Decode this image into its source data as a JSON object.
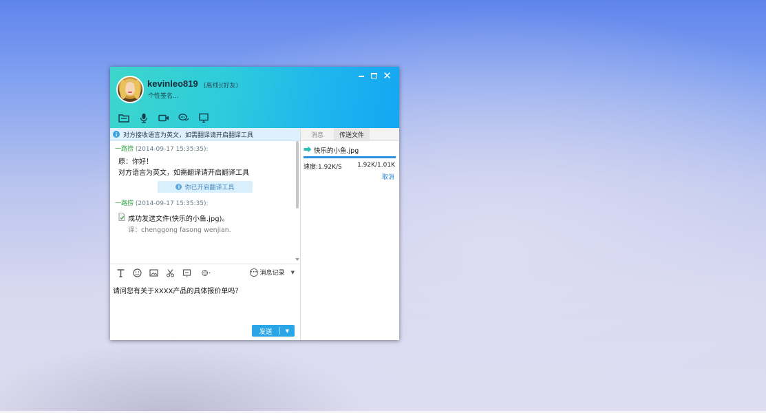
{
  "window": {
    "contact": {
      "nickname": "kevinleo819",
      "status": "[离线](好友)",
      "signature": "个性签名..."
    },
    "controls": {
      "minimize": "—",
      "maximize": "□",
      "close": "✕"
    },
    "top_toolbar": [
      "folder-icon",
      "microphone-icon",
      "video-camera-icon",
      "chat-bubbles-icon",
      "screen-share-icon"
    ],
    "notice": {
      "icon": "i",
      "text": "对方接收语言为英文，如需翻译请开启翻译工具"
    },
    "messages": [
      {
        "sender": "一路捞",
        "time": "(2014-09-17 15:35:35):",
        "lines": [
          "原：你好！",
          "对方语言为英文，如需翻译请开启翻译工具"
        ],
        "pill": "你已开启翻译工具"
      },
      {
        "sender": "一路捞",
        "time": "(2014-09-17 15:35:35):",
        "file_text": "成功发送文件(快乐的小鱼.jpg)。",
        "translit": "译：chenggong fasong wenjian."
      }
    ],
    "input_toolbar": {
      "tools": [
        "font-icon",
        "emoji-icon",
        "image-icon",
        "scissors-icon",
        "shake-icon",
        "globe-icon"
      ],
      "history_label": "消息记录",
      "history_caret": "▼"
    },
    "input": {
      "text": "请问您有关于XXXX产品的具体报价单吗？"
    },
    "send": {
      "label": "发送",
      "dropdown": "▼"
    },
    "right_panel": {
      "tabs": [
        "消息",
        "传送文件"
      ],
      "active_tab": 1,
      "transfer": {
        "file_name": "快乐的小鱼.jpg",
        "progress": 1.0,
        "speed": "速度:1.92K/S",
        "size": "1.92K/1.01K",
        "cancel": "取消"
      }
    },
    "colors": {
      "title_gradient_start": "#3dd6cc",
      "title_gradient_end": "#15a6f2",
      "sender_name": "#3aa84c",
      "send_button": "#2aa6e6",
      "link": "#2a86d6"
    }
  }
}
